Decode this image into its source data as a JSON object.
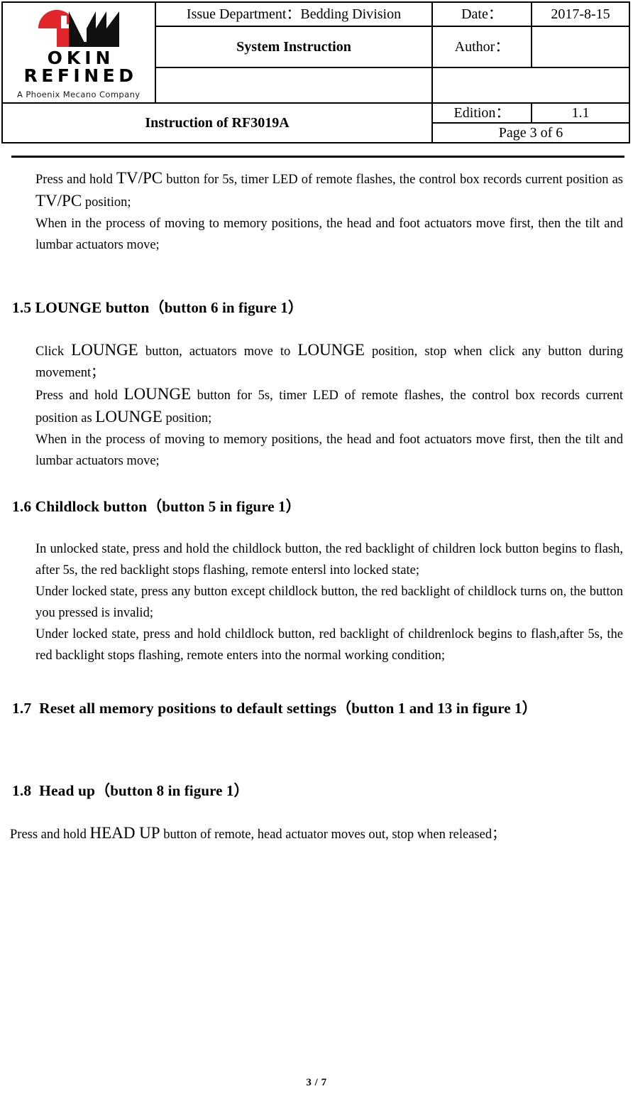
{
  "header": {
    "logo": {
      "brand_line1": "OKIN",
      "brand_line2": "REFINED",
      "tagline": "A Phoenix Mecano Company",
      "red_hex": "#E3262B",
      "black_hex": "#101010"
    },
    "issue_department_label": "Issue Department：Bedding Division",
    "date_label": "Date：",
    "date_value": "2017-8-15",
    "system_instruction": "System Instruction",
    "author_label": "Author：",
    "author_value": "",
    "blank_left": "",
    "blank_right": "",
    "doc_title": "Instruction of RF3019A",
    "edition_label": "Edition：",
    "edition_value": "1.1",
    "page_label": "Page 3 of 6"
  },
  "body": {
    "intro": {
      "line1_a": "Press and hold ",
      "line1_b": "TV/PC",
      "line1_c": " button for 5s, timer LED of remote flashes, the control box records current position as ",
      "line1_d": "TV/PC",
      "line1_e": " position;",
      "line2": "When in the process of moving to memory positions, the head and foot actuators move first, then the tilt and lumbar actuators move;"
    },
    "sections": [
      {
        "number": "1.5",
        "title": "LOUNGE button",
        "paren": "（button 6 in figure 1）",
        "p1_a": "Click ",
        "p1_b": "LOUNGE",
        "p1_c": " button, actuators move to ",
        "p1_d": "LOUNGE",
        "p1_e": " position, stop when click any button during movement；",
        "p2_a": "Press and hold ",
        "p2_b": "LOUNGE",
        "p2_c": " button for 5s, timer LED of remote flashes, the control box records current position as ",
        "p2_d": "LOUNGE",
        "p2_e": " position;",
        "p3": "When in the process of moving to memory positions, the head and foot actuators move first, then the tilt and lumbar actuators move;"
      },
      {
        "number": "1.6",
        "title": "Childlock button",
        "paren": "（button 5 in figure 1）",
        "p1": "In unlocked state, press and hold the childlock button, the red backlight of children lock button begins to flash, after 5s, the red backlight stops flashing, remote entersl into locked state;",
        "p2": "Under locked state, press any button except childlock button, the red backlight of childlock turns on,    the button you pressed is invalid;",
        "p3": "Under locked state, press and hold childlock button, red backlight of childrenlock begins to flash,after 5s, the red backlight stops flashing, remote enters into the normal working condition;"
      },
      {
        "number": "1.7",
        "title": "Reset all memory positions to default settings",
        "paren": "（button 1 and 13 in figure 1）"
      },
      {
        "number": "1.8",
        "title": "Head up",
        "paren": "（button 8 in figure 1）",
        "p1_a": "Press and hold ",
        "p1_b": "HEAD UP",
        "p1_c": " button of remote, head actuator moves out, stop when released；"
      }
    ]
  },
  "footer": {
    "page_number": "3 / 7"
  }
}
